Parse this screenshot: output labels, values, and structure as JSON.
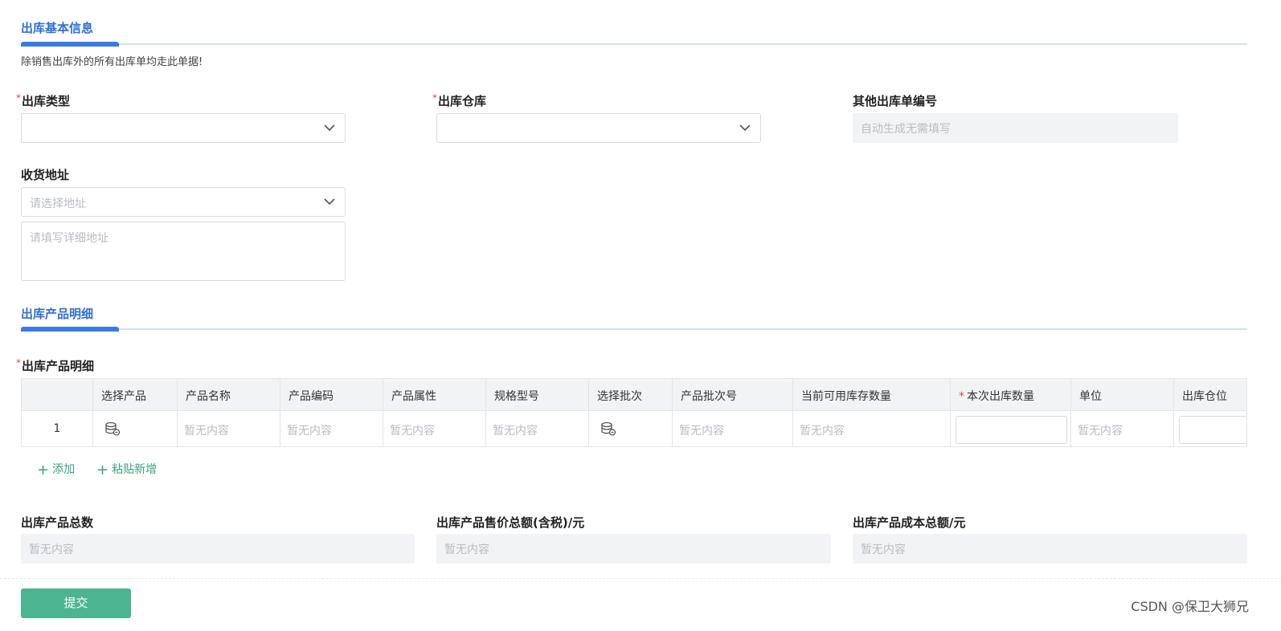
{
  "sections": {
    "basic": {
      "title": "出库基本信息",
      "hint": "除销售出库外的所有出库单均走此单据!"
    },
    "products": {
      "title": "出库产品明细"
    }
  },
  "form": {
    "outbound_type": {
      "label": "出库类型",
      "value": ""
    },
    "warehouse": {
      "label": "出库仓库",
      "value": ""
    },
    "order_no": {
      "label": "其他出库单编号",
      "placeholder": "自动生成无需填写"
    },
    "address": {
      "label": "收货地址",
      "select_placeholder": "请选择地址",
      "detail_placeholder": "请填写详细地址"
    }
  },
  "table": {
    "label": "出库产品明细",
    "columns": [
      "",
      "选择产品",
      "产品名称",
      "产品编码",
      "产品属性",
      "规格型号",
      "选择批次",
      "产品批次号",
      "当前可用库存数量",
      "本次出库数量",
      "单位",
      "出库仓位"
    ],
    "rows": [
      {
        "index": "1",
        "product_name": "暂无内容",
        "product_code": "暂无内容",
        "product_attr": "暂无内容",
        "spec": "暂无内容",
        "batch_no": "暂无内容",
        "stock": "暂无内容",
        "quantity": "",
        "unit": "暂无内容",
        "location": ""
      }
    ]
  },
  "actions": {
    "add": "添加",
    "paste_add": "粘贴新增",
    "submit": "提交"
  },
  "totals": {
    "count": {
      "label": "出库产品总数",
      "value": "暂无内容"
    },
    "sale_total": {
      "label": "出库产品售价总额(含税)/元",
      "value": "暂无内容"
    },
    "cost_total": {
      "label": "出库产品成本总额/元",
      "value": "暂无内容"
    }
  },
  "watermark": "CSDN @保卫大狮兄",
  "colors": {
    "accent": "#3b7be0",
    "primary_button": "#4cb490",
    "link": "#3aa37a",
    "required": "#e04848"
  }
}
